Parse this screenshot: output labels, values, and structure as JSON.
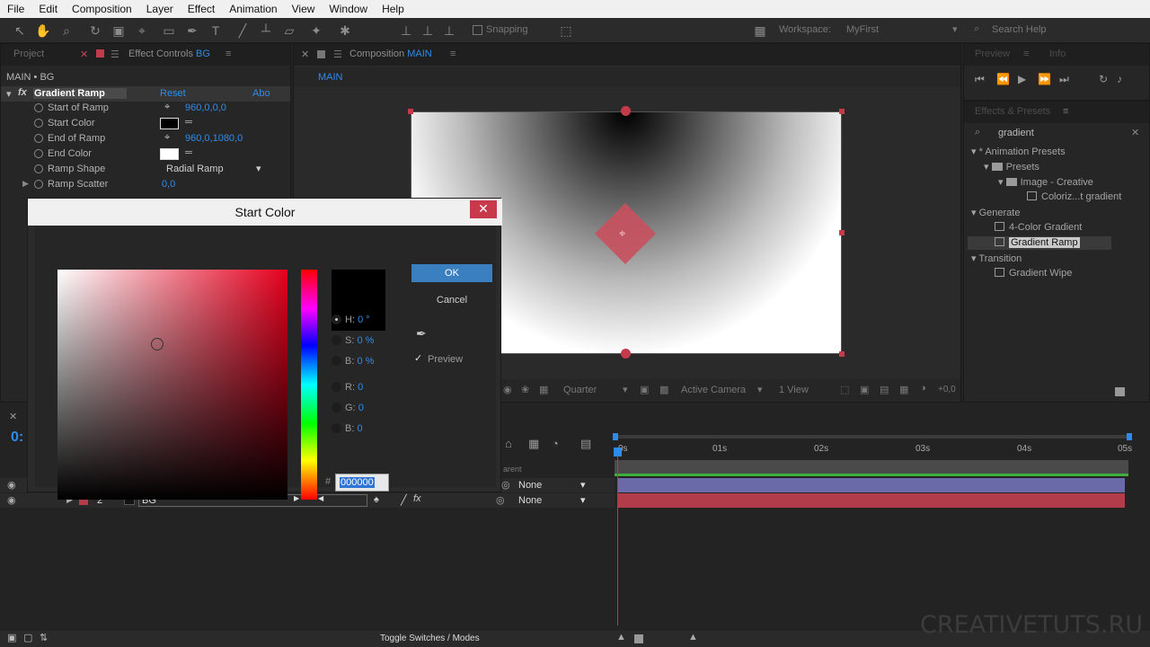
{
  "menu": [
    "File",
    "Edit",
    "Composition",
    "Layer",
    "Effect",
    "Animation",
    "View",
    "Window",
    "Help"
  ],
  "toolbar": {
    "snapping_label": "Snapping",
    "workspace_label": "Workspace:",
    "workspace_value": "MyFirst",
    "search_placeholder": "Search Help"
  },
  "left_panel": {
    "tab_project": "Project",
    "tab_effect_controls": "Effect Controls",
    "tab_effect_controls_layer": "BG",
    "breadcrumb": "MAIN • BG",
    "effect_name": "Gradient Ramp",
    "reset_label": "Reset",
    "about_label": "Abo",
    "properties": [
      {
        "label": "Start of Ramp",
        "value": "960,0,0,0"
      },
      {
        "label": "Start Color",
        "value": ""
      },
      {
        "label": "End of Ramp",
        "value": "960,0,1080,0"
      },
      {
        "label": "End Color",
        "value": ""
      },
      {
        "label": "Ramp Shape",
        "value": "Radial Ramp"
      },
      {
        "label": "Ramp Scatter",
        "value": "0,0"
      }
    ]
  },
  "composition_panel": {
    "tab_label": "Composition",
    "tab_comp_name": "MAIN",
    "flowchart_label": "MAIN",
    "resolution": "Quarter",
    "camera": "Active Camera",
    "views": "1 View",
    "exposure": "+0,0"
  },
  "right_panel": {
    "tab_preview": "Preview",
    "tab_info": "Info",
    "effects_presets_title": "Effects & Presets",
    "search_value": "gradient",
    "tree": [
      {
        "label": "* Animation Presets",
        "level": 0,
        "kind": "group"
      },
      {
        "label": "Presets",
        "level": 1,
        "kind": "folder"
      },
      {
        "label": "Image - Creative",
        "level": 2,
        "kind": "folder"
      },
      {
        "label": "Coloriz...t gradient",
        "level": 3,
        "kind": "preset"
      },
      {
        "label": "Generate",
        "level": 0,
        "kind": "group"
      },
      {
        "label": "4-Color Gradient",
        "level": 1,
        "kind": "effect"
      },
      {
        "label": "Gradient Ramp",
        "level": 1,
        "kind": "effect",
        "selected": true
      },
      {
        "label": "Transition",
        "level": 0,
        "kind": "group"
      },
      {
        "label": "Gradient Wipe",
        "level": 1,
        "kind": "effect"
      }
    ]
  },
  "dialog": {
    "title": "Start Color",
    "ok_label": "OK",
    "cancel_label": "Cancel",
    "preview_label": "Preview",
    "h_label": "H:",
    "h_value": "0 °",
    "s_label": "S:",
    "s_value": "0 %",
    "b_label": "B:",
    "b_value": "0 %",
    "r_label": "R:",
    "r_value": "0",
    "g_label": "G:",
    "g_value": "0",
    "bb_label": "B:",
    "bb_value": "0",
    "hex_prefix": "#",
    "hex_value": "000000",
    "current_color": "#000000"
  },
  "timeline": {
    "time_display": "0:",
    "parent_header": "arent",
    "ruler": [
      "0s",
      "01s",
      "02s",
      "03s",
      "04s",
      "05s"
    ],
    "layers": [
      {
        "num": "",
        "name": "",
        "parent": "None",
        "color": "#6a6aa8"
      },
      {
        "num": "2",
        "name": "BG",
        "parent": "None",
        "color": "#b23c4a"
      }
    ],
    "toggle_label": "Toggle Switches / Modes"
  },
  "watermark": "CREATIVETUTS.RU"
}
